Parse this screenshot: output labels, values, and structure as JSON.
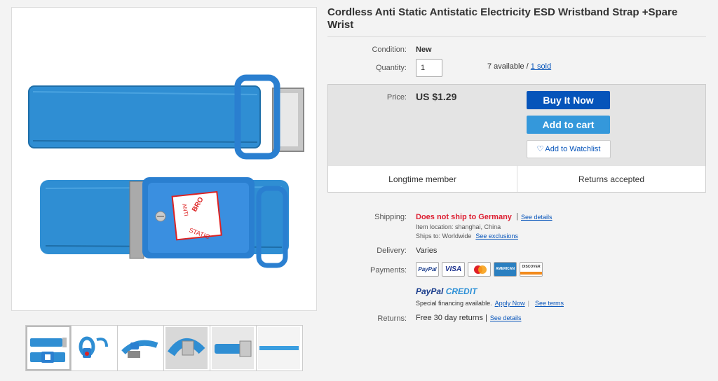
{
  "product": {
    "title": "Cordless Anti Static Antistatic Electricity ESD Wristband Strap +Spare Wrist",
    "image_text": {
      "line1": "BRO",
      "line2": "ANTI",
      "line3": "STATIC"
    }
  },
  "details": {
    "condition_label": "Condition:",
    "condition_value": "New",
    "quantity_label": "Quantity:",
    "quantity_value": "1",
    "available_text": "7 available / ",
    "sold_link": "1 sold"
  },
  "purchase": {
    "price_label": "Price:",
    "price_value": "US $1.29",
    "buy_now": "Buy It Now",
    "add_to_cart": "Add to cart",
    "add_to_watchlist": "Add to Watchlist",
    "badge_left": "Longtime member",
    "badge_right": "Returns accepted"
  },
  "shipping": {
    "label": "Shipping:",
    "value": "Does not ship to Germany",
    "separator": "|",
    "see_details": "See details",
    "item_location": "Item location:  shanghai, China",
    "ships_to": "Ships to:  Worldwide",
    "see_exclusions": "See exclusions"
  },
  "delivery": {
    "label": "Delivery:",
    "value": "Varies"
  },
  "payments": {
    "label": "Payments:",
    "cards": [
      "PayPal",
      "VISA",
      "",
      "AMERICAN EXPRESS",
      "DISCOVER"
    ],
    "paypal_credit_1": "PayPal",
    "paypal_credit_2": "CREDIT",
    "financing_text": "Special financing available.",
    "apply_now": "Apply Now",
    "bar": "|",
    "see_terms": "See terms"
  },
  "returns": {
    "label": "Returns:",
    "value": "Free 30 day returns",
    "separator": "|",
    "see_details": "See details"
  },
  "colors": {
    "buy_now": "#0654ba",
    "add_to_cart": "#3498db",
    "shipping_warning": "#dd1e31",
    "link": "#0654ba",
    "strap_blue": "#2f8ed3"
  }
}
